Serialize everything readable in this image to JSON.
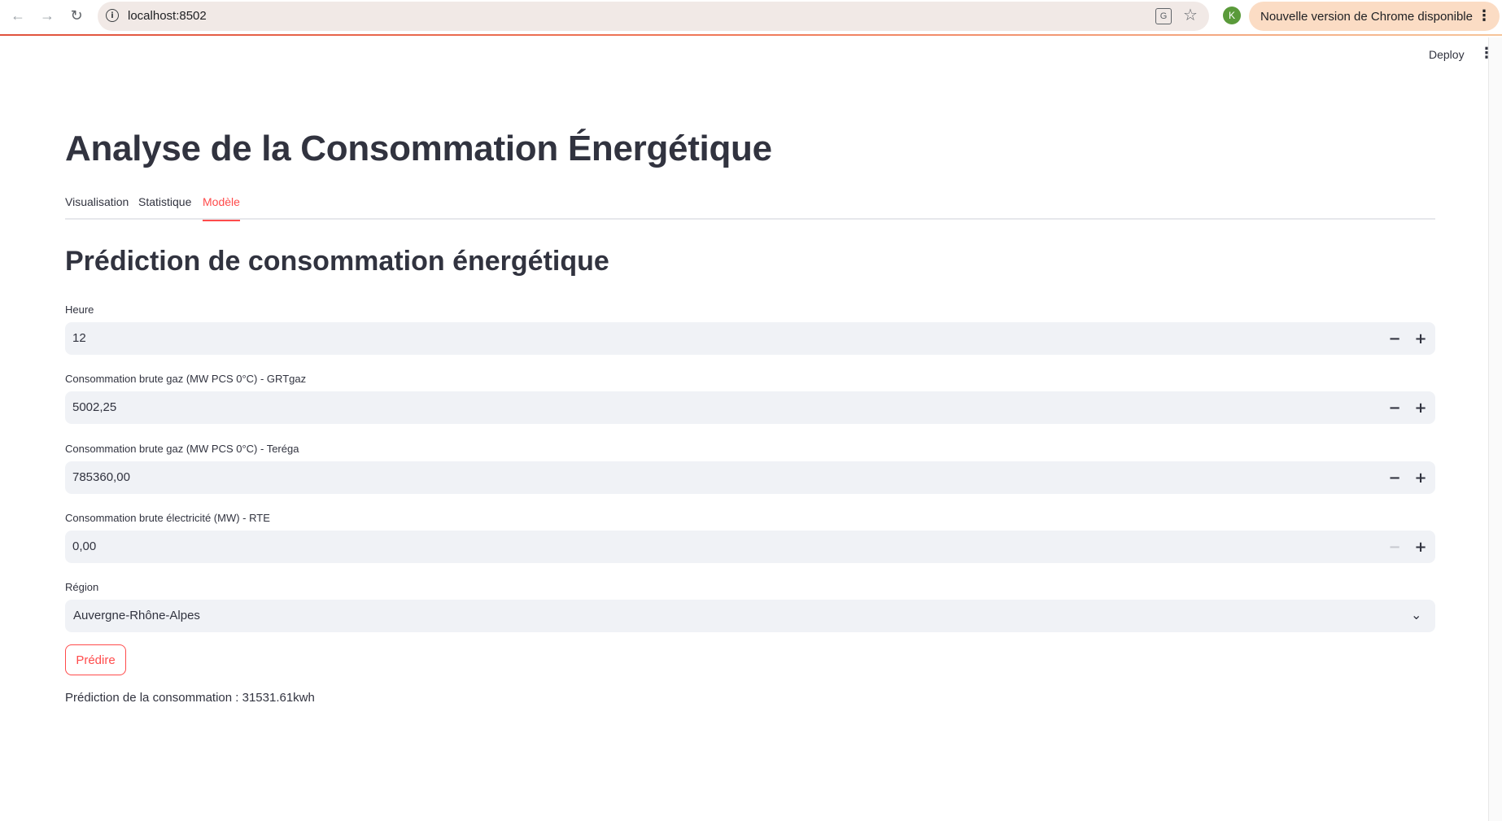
{
  "browser": {
    "url": "localhost:8502",
    "update_banner": "Nouvelle version de Chrome disponible",
    "profile_initial": "K"
  },
  "header": {
    "deploy_label": "Deploy"
  },
  "page": {
    "title": "Analyse de la Consommation Énergétique",
    "tabs": [
      {
        "label": "Visualisation",
        "active": false
      },
      {
        "label": "Statistique",
        "active": false
      },
      {
        "label": "Modèle",
        "active": true
      }
    ],
    "section_title": "Prédiction de consommation énergétique"
  },
  "form": {
    "fields": [
      {
        "label": "Heure",
        "value": "12"
      },
      {
        "label": "Consommation brute gaz (MW PCS 0°C) - GRTgaz",
        "value": "5002,25"
      },
      {
        "label": "Consommation brute gaz (MW PCS 0°C) - Teréga",
        "value": "785360,00"
      },
      {
        "label": "Consommation brute électricité (MW) - RTE",
        "value": "0,00"
      }
    ],
    "region_label": "Région",
    "region_value": "Auvergne-Rhône-Alpes",
    "predict_label": "Prédire"
  },
  "result": {
    "text": "Prédiction de la consommation : 31531.61kwh"
  },
  "colors": {
    "accent": "#ff4b4b",
    "input_bg": "#f0f2f6",
    "text": "#31333f"
  }
}
